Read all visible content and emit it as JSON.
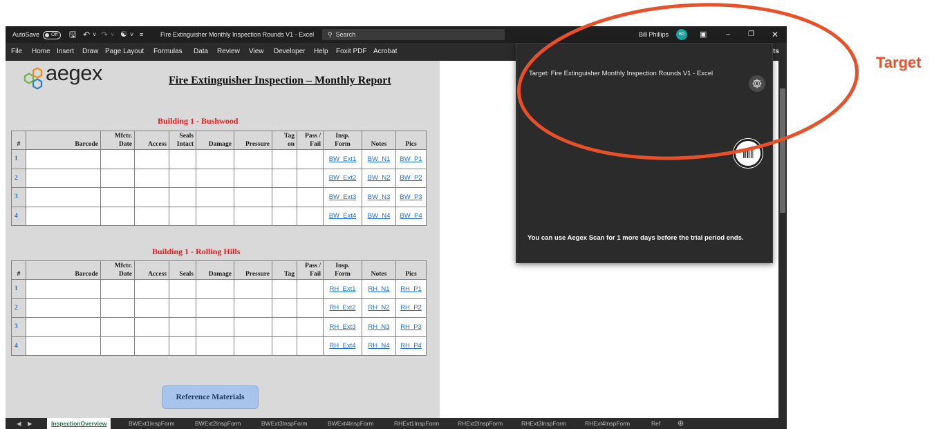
{
  "titlebar": {
    "autosave_label": "AutoSave",
    "autosave_state": "Off",
    "document_title": "Fire Extinguisher Monthly Inspection Rounds V1 - Excel",
    "search_placeholder": "Search",
    "user_name": "Bill Phillips",
    "user_initials": "BP"
  },
  "ribbon": {
    "tabs": [
      "File",
      "Home",
      "Insert",
      "Draw",
      "Page Layout",
      "Formulas",
      "Data",
      "Review",
      "View",
      "Developer",
      "Help",
      "Foxit PDF",
      "Acrobat"
    ],
    "overflow_fragment": "ts"
  },
  "logo": {
    "text": "aegex",
    "colors": {
      "orange": "#f08c1e",
      "blue": "#2a83c6",
      "green": "#6fb73f"
    }
  },
  "report": {
    "title": "Fire Extinguisher Inspection – Monthly Report"
  },
  "section1": {
    "title": "Building 1 - Bushwood",
    "headers": [
      [
        "#"
      ],
      [
        "Barcode"
      ],
      [
        "Mfctr.",
        "Date"
      ],
      [
        "Access"
      ],
      [
        "Seals",
        "Intact"
      ],
      [
        "Damage"
      ],
      [
        "Pressure"
      ],
      [
        "Tag",
        "on"
      ],
      [
        "Pass /",
        "Fail"
      ],
      [
        "Insp.",
        "Form"
      ],
      [
        "Notes"
      ],
      [
        "Pics"
      ]
    ],
    "rows": [
      {
        "num": "1",
        "form": "BW_Ext1",
        "notes": "BW_N1",
        "pics": "BW_P1"
      },
      {
        "num": "2",
        "form": "BW_Ext2",
        "notes": "BW_N2",
        "pics": "BW_P2"
      },
      {
        "num": "3",
        "form": "BW_Ext3",
        "notes": "BW_N3",
        "pics": "BW_P3"
      },
      {
        "num": "4",
        "form": "BW_Ext4",
        "notes": "BW_N4",
        "pics": "BW_P4"
      }
    ]
  },
  "section2": {
    "title": "Building 1 - Rolling Hills",
    "headers": [
      [
        "#"
      ],
      [
        "Barcode"
      ],
      [
        "Mfctr.",
        "Date"
      ],
      [
        "Access"
      ],
      [
        "Seals"
      ],
      [
        "Damage"
      ],
      [
        "Pressure"
      ],
      [
        "Tag"
      ],
      [
        "Pass /",
        "Fail"
      ],
      [
        "Insp.",
        "Form"
      ],
      [
        "Notes"
      ],
      [
        "Pics"
      ]
    ],
    "rows": [
      {
        "num": "1",
        "form": "RH_Ext1",
        "notes": "RH_N1",
        "pics": "RH_P1"
      },
      {
        "num": "2",
        "form": "RH_Ext2",
        "notes": "RH_N2",
        "pics": "RH_P2"
      },
      {
        "num": "3",
        "form": "RH_Ext3",
        "notes": "RH_N3",
        "pics": "RH_P3"
      },
      {
        "num": "4",
        "form": "RH_Ext4",
        "notes": "RH_N4",
        "pics": "RH_P4"
      }
    ]
  },
  "reference_button": "Reference Materials",
  "sheet_tabs": {
    "active": "InspectionOverview",
    "others": [
      "BWExt1InspForm",
      "BWExt2InspForm",
      "BWExt3InspForm",
      "BWExt4InspForm",
      "RHExt1InspForm",
      "RHExt2InspForm",
      "RHExt3InspForm",
      "RHExt4InspForm",
      "Ref"
    ]
  },
  "popup": {
    "target_text": "Target: Fire Extinguisher Monthly Inspection Rounds V1 - Excel",
    "trial_text": "You can use Aegex Scan for 1 more days before the trial period ends."
  },
  "annotation": {
    "label": "Target",
    "color": "#e8502a"
  }
}
